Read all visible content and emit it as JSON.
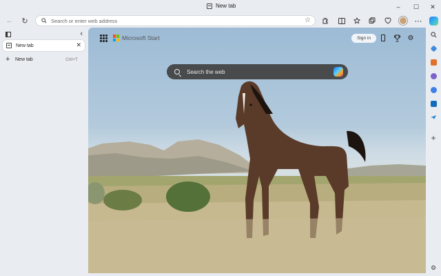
{
  "window": {
    "title": "New tab",
    "controls": {
      "minimize": "–",
      "maximize": "☐",
      "close": "✕"
    }
  },
  "toolbar": {
    "back_glyph": "←",
    "refresh_glyph": "↻",
    "address_placeholder": "Search or enter web address",
    "favorite_glyph": "☆",
    "more_glyph": "⋯"
  },
  "vertical_tabs": {
    "collapse_glyph": "‹",
    "tabs": [
      {
        "label": "New tab",
        "close_glyph": "✕"
      }
    ],
    "new_tab": {
      "label": "New tab",
      "shortcut": "Ctrl+T",
      "plus": "+"
    }
  },
  "newtab_page": {
    "brand": "Microsoft Start",
    "signin_label": "Sign in",
    "search_placeholder": "Search the web"
  },
  "sidebar": {
    "add_glyph": "+",
    "settings_glyph": "⚙",
    "colors": {
      "shopping": "#e0702a",
      "tools": "#3b74d6",
      "games": "#7a63c9",
      "m365": "#3f7fe8",
      "outlook": "#0f6cbd",
      "drop": "#1f86d6"
    }
  }
}
